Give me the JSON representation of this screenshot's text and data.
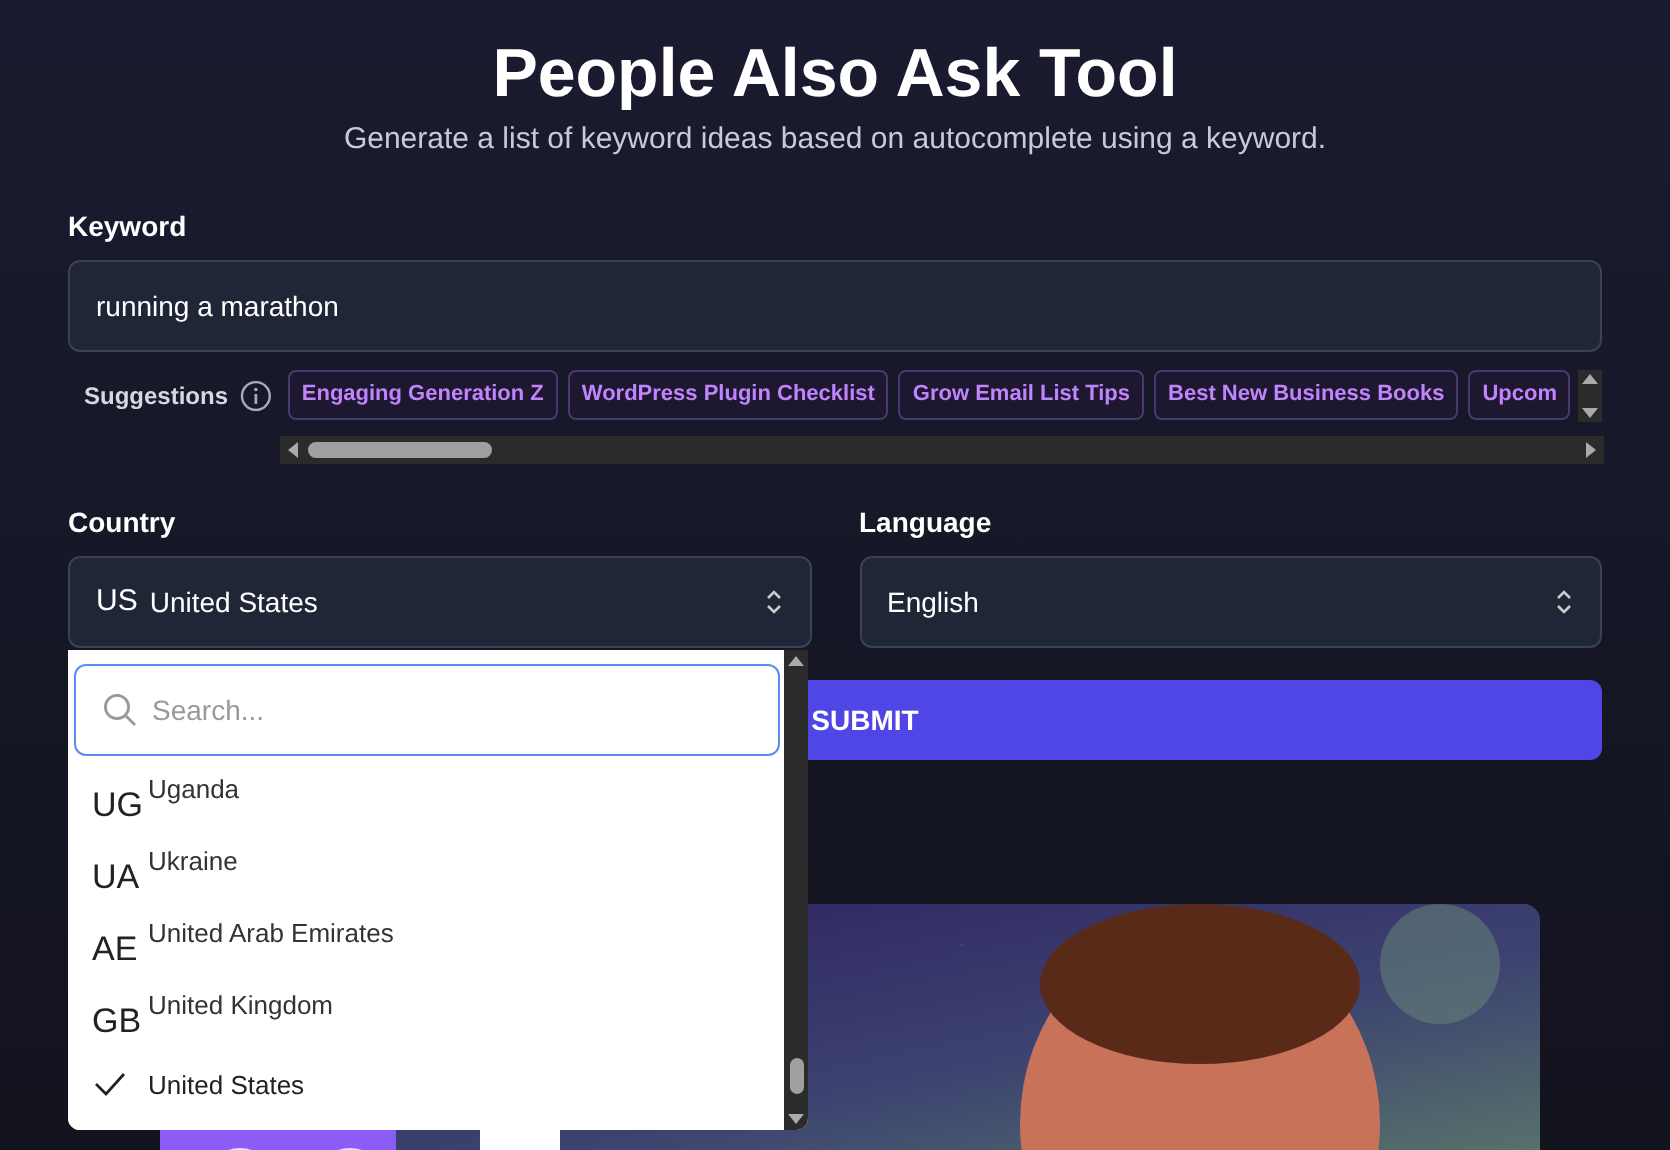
{
  "title": "People Also Ask Tool",
  "subtitle": "Generate a list of keyword ideas based on autocomplete using a keyword.",
  "keyword": {
    "label": "Keyword",
    "value": "running a marathon"
  },
  "suggestions": {
    "label": "Suggestions",
    "items": [
      "Engaging Generation Z",
      "WordPress Plugin Checklist",
      "Grow Email List Tips",
      "Best New Business Books",
      "Upcom"
    ]
  },
  "country": {
    "label": "Country",
    "code": "US",
    "value": "United States"
  },
  "language": {
    "label": "Language",
    "value": "English"
  },
  "submit": "SUBMIT",
  "country_dropdown": {
    "search_placeholder": "Search...",
    "options": [
      {
        "code": "UG",
        "name": "Uganda",
        "selected": false
      },
      {
        "code": "UA",
        "name": "Ukraine",
        "selected": false
      },
      {
        "code": "AE",
        "name": "United Arab Emirates",
        "selected": false
      },
      {
        "code": "GB",
        "name": "United Kingdom",
        "selected": false
      },
      {
        "name": "United States",
        "selected": true
      }
    ]
  }
}
